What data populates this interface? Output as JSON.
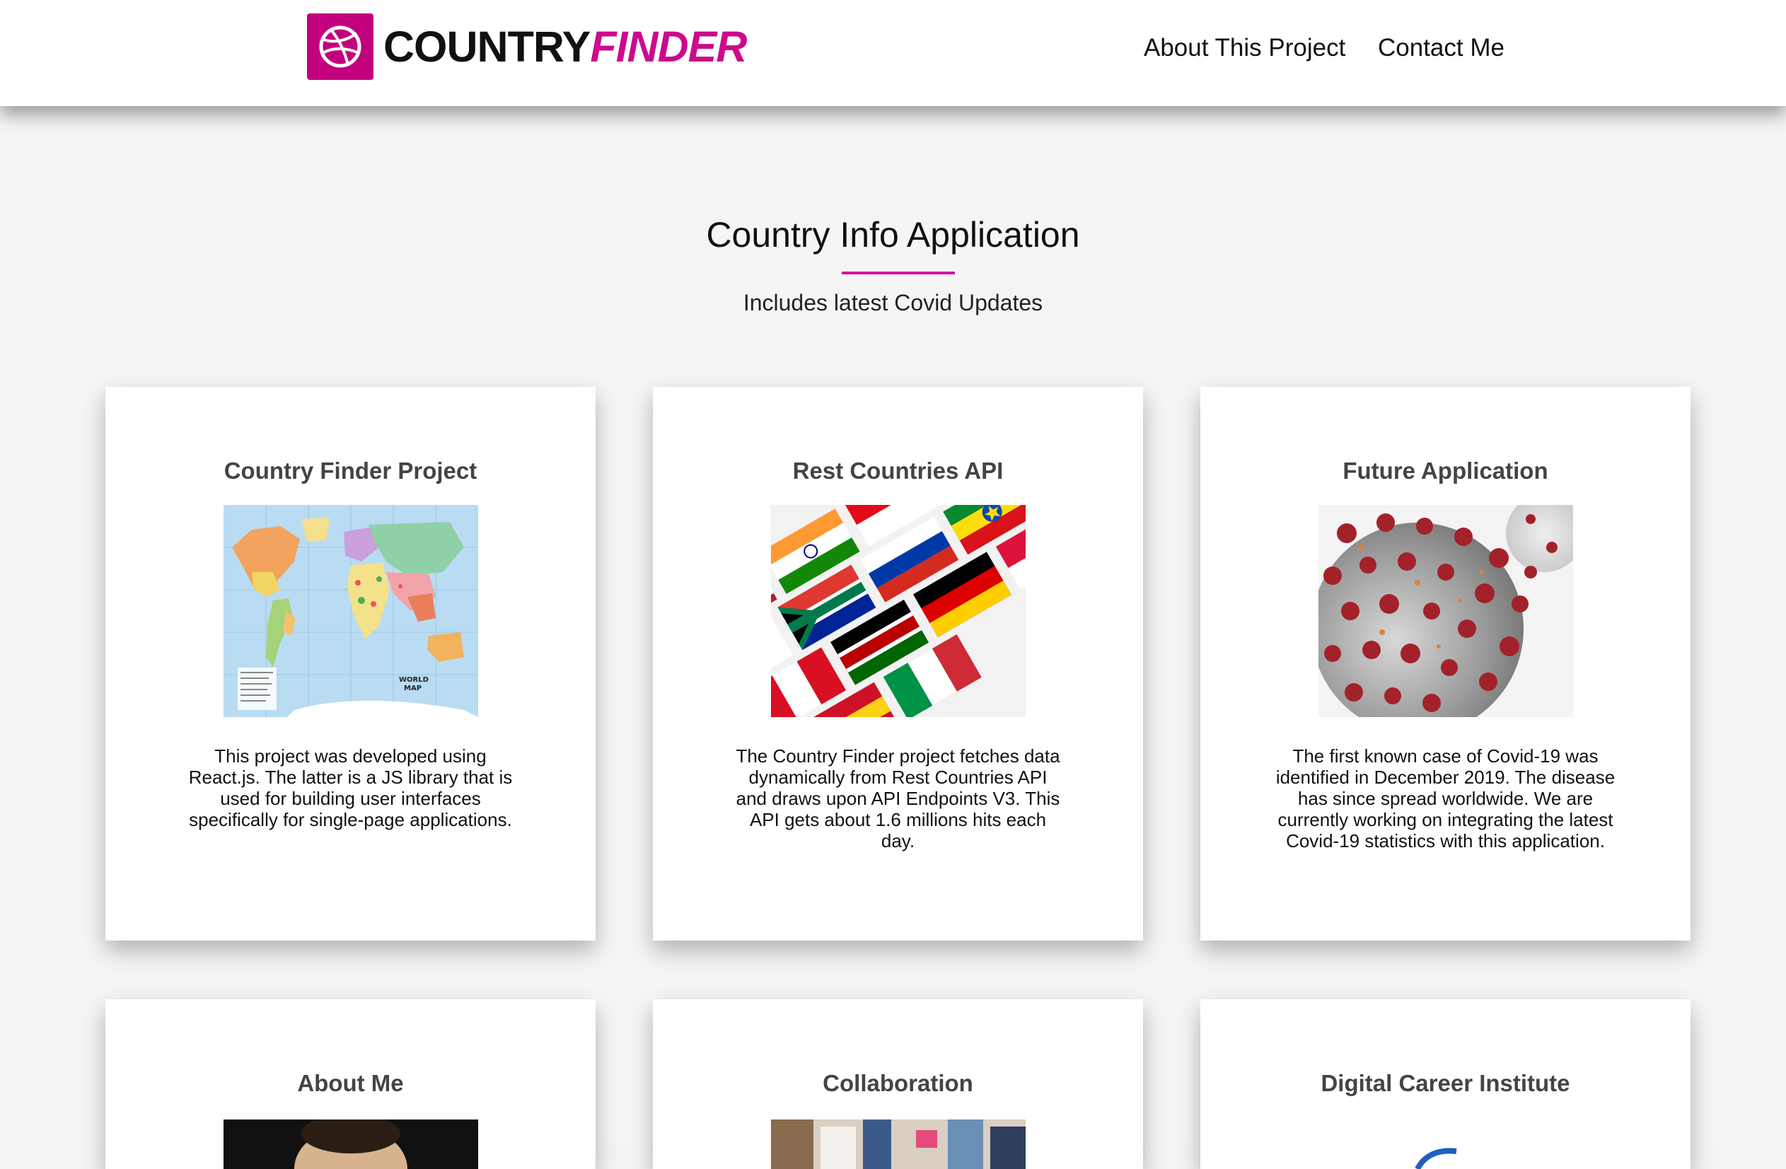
{
  "navbar": {
    "logo_primary": "COUNTRY",
    "logo_secondary": "FINDER",
    "logo_icon": "dribbble-ball-icon",
    "links": [
      "About This Project",
      "Contact Me"
    ]
  },
  "hero": {
    "title": "Country Info Application",
    "subtitle": "Includes latest Covid Updates"
  },
  "cards": [
    {
      "title": "Country Finder Project",
      "image": "world-map",
      "text": "This project was developed using React.js. The latter is a JS library that is used for building user interfaces specifically for single-page applications."
    },
    {
      "title": "Rest Countries API",
      "image": "national-flags",
      "text": "The Country Finder project fetches data dynamically from Rest Countries API and draws upon API Endpoints V3. This API gets about 1.6 millions hits each day."
    },
    {
      "title": "Future Application",
      "image": "coronavirus",
      "text": "The first known case of Covid-19 was identified in December 2019. The disease has since spread worldwide. We are currently working on integrating the latest Covid-19 statistics with this application."
    },
    {
      "title": "About Me",
      "image": "portrait"
    },
    {
      "title": "Collaboration",
      "image": "team-meeting"
    },
    {
      "title": "Digital Career Institute",
      "image": "institute-logo"
    }
  ],
  "colors": {
    "brand": "#c2007e",
    "accent": "#d3179d",
    "background": "#f5f5f5",
    "card": "#ffffff"
  }
}
